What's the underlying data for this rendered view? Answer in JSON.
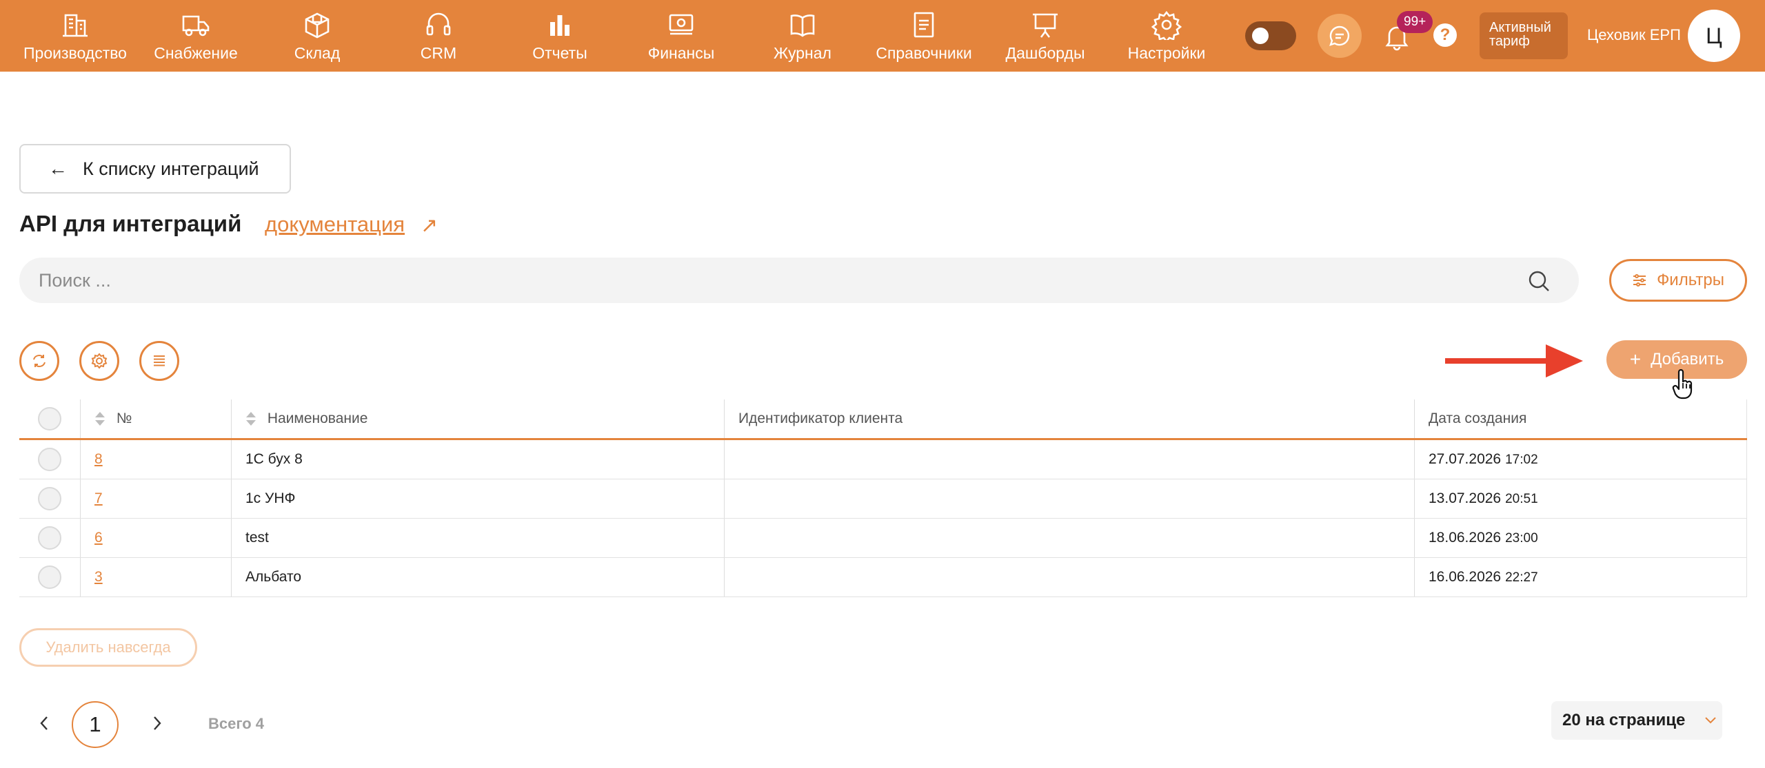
{
  "topbar": {
    "nav": [
      {
        "label": "Производство",
        "icon": "building-icon"
      },
      {
        "label": "Снабжение",
        "icon": "truck-icon"
      },
      {
        "label": "Склад",
        "icon": "box-icon"
      },
      {
        "label": "CRM",
        "icon": "headset-icon"
      },
      {
        "label": "Отчеты",
        "icon": "bar-chart-icon"
      },
      {
        "label": "Финансы",
        "icon": "money-icon"
      },
      {
        "label": "Журнал",
        "icon": "book-icon"
      },
      {
        "label": "Справочники",
        "icon": "document-icon"
      },
      {
        "label": "Дашборды",
        "icon": "presentation-board-icon"
      },
      {
        "label": "Настройки",
        "icon": "gear-icon"
      }
    ],
    "notifications_badge": "99+",
    "help_label": "?",
    "tariff_label": "Активный тариф",
    "company_name": "Цеховик ЕРП",
    "avatar_letter": "Ц"
  },
  "main": {
    "back_label": "К списку интеграций",
    "title": "API для интеграций",
    "doc_link": "документация",
    "search_placeholder": "Поиск ...",
    "filters_label": "Фильтры",
    "add_label": "Добавить"
  },
  "table": {
    "columns": [
      "№",
      "Наименование",
      "Идентификатор клиента",
      "Дата создания"
    ],
    "rows": [
      {
        "id": "8",
        "name": "1С бух 8",
        "client_id": "",
        "date": "27.07.2026",
        "time": "17:02"
      },
      {
        "id": "7",
        "name": "1с УНФ",
        "client_id": "",
        "date": "13.07.2026",
        "time": "20:51"
      },
      {
        "id": "6",
        "name": "test",
        "client_id": "",
        "date": "18.06.2026",
        "time": "23:00"
      },
      {
        "id": "3",
        "name": "Альбато",
        "client_id": "",
        "date": "16.06.2026",
        "time": "22:27"
      }
    ]
  },
  "footer": {
    "delete_label": "Удалить навсегда",
    "current_page": "1",
    "total_label": "Всего 4",
    "per_page_label": "20 на странице"
  },
  "colors": {
    "accent": "#e4843c",
    "annotation_arrow": "#e8402c"
  }
}
